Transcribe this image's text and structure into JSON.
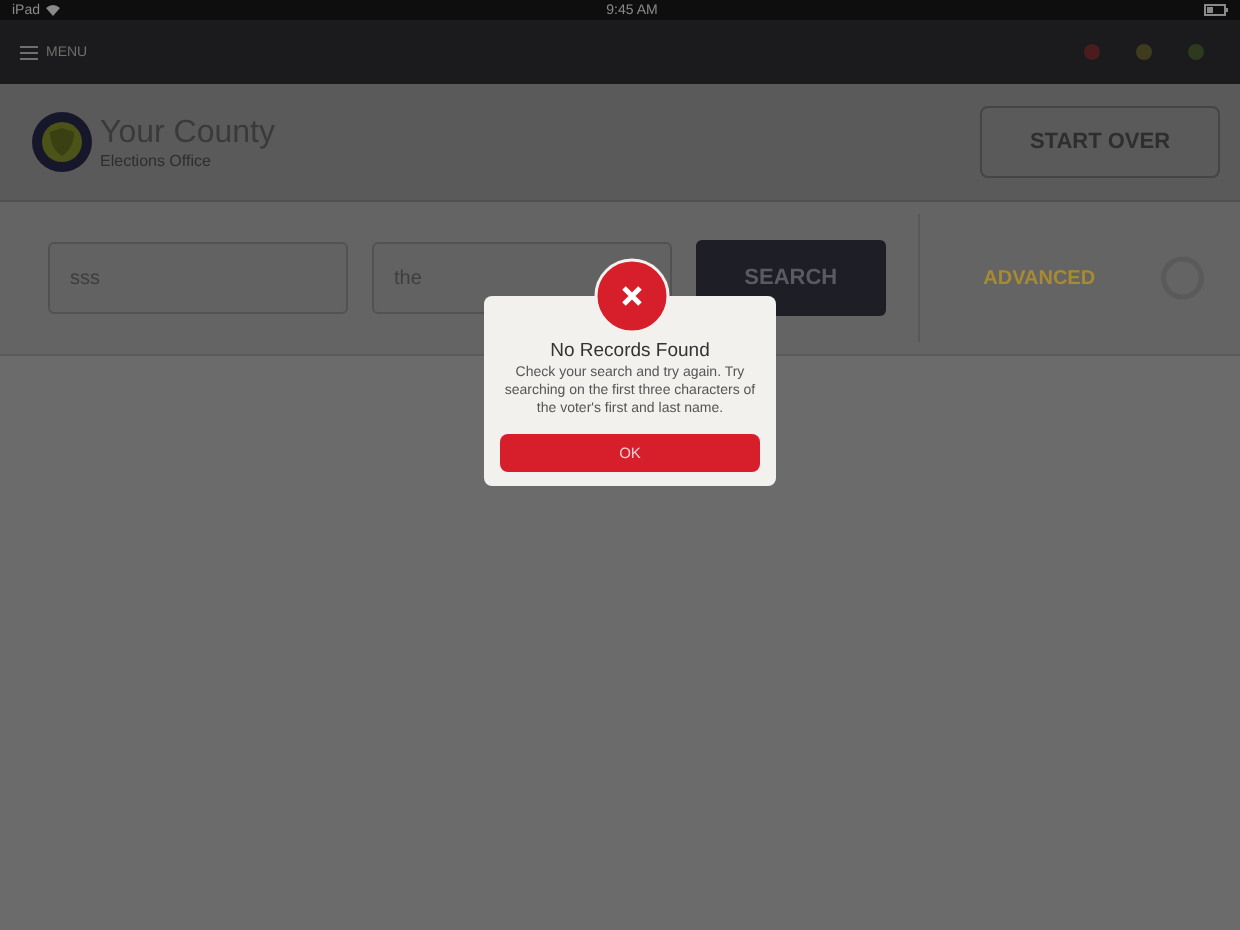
{
  "status_bar": {
    "carrier": "iPad",
    "time": "9:45 AM"
  },
  "top_bar": {
    "menu_label": "MENU"
  },
  "header": {
    "title": "Your County",
    "subtitle": "Elections Office",
    "start_over": "START OVER"
  },
  "search": {
    "fields": [
      {
        "value": "sss"
      },
      {
        "value": "the"
      }
    ],
    "button": "SEARCH",
    "advanced": "ADVANCED"
  },
  "dialog": {
    "title": "No Records Found",
    "message": "Check your search and try again. Try searching on the first three characters of the voter's first and last name.",
    "button": "OK"
  }
}
